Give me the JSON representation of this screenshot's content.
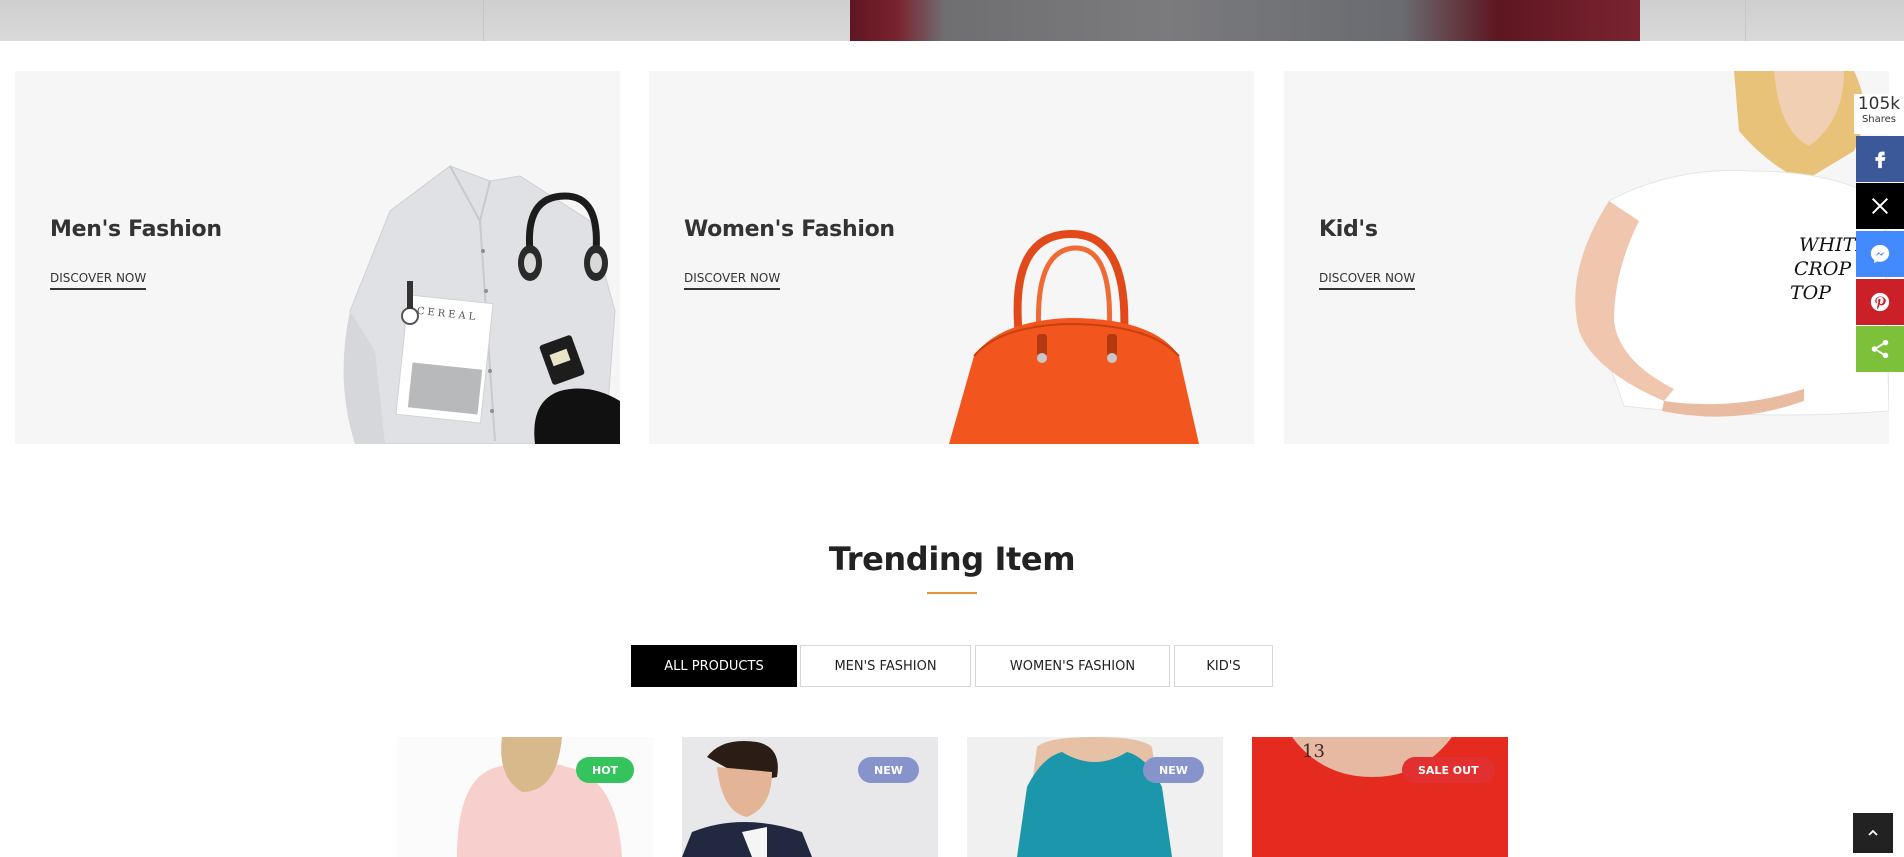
{
  "banners": [
    {
      "title": "Men's Fashion",
      "link": "DISCOVER NOW"
    },
    {
      "title": "Women's Fashion",
      "link": "DISCOVER NOW"
    },
    {
      "title": "Kid's",
      "link": "DISCOVER NOW"
    }
  ],
  "banner_art": {
    "cereal_text": "CEREAL",
    "crop_top_text": [
      "WHITE",
      "CROP",
      "TOP"
    ]
  },
  "trending": {
    "title": "Trending Item",
    "tabs": [
      "ALL PRODUCTS",
      "MEN'S FASHION",
      "WOMEN'S FASHION",
      "KID'S"
    ],
    "active_tab": "ALL PRODUCTS"
  },
  "products": [
    {
      "badge": "HOT",
      "badge_color": "#35c35e"
    },
    {
      "badge": "NEW",
      "badge_color": "#8794cb"
    },
    {
      "badge": "NEW",
      "badge_color": "#8794cb"
    },
    {
      "badge": "SALE OUT",
      "badge_color": "#e22f2f",
      "number_text": "13"
    }
  ],
  "share": {
    "count": "105k",
    "label": "Shares",
    "buttons": [
      {
        "name": "facebook",
        "icon": "facebook-icon",
        "color": "#3b5998"
      },
      {
        "name": "twitter",
        "icon": "x-icon",
        "color": "#000000"
      },
      {
        "name": "messenger",
        "icon": "messenger-icon",
        "color": "#448aff"
      },
      {
        "name": "pinterest",
        "icon": "pinterest-icon",
        "color": "#cb2027"
      },
      {
        "name": "sharethis",
        "icon": "share-icon",
        "color": "#7dc13a"
      }
    ]
  },
  "back_to_top": {
    "icon": "chevron-up-icon"
  }
}
